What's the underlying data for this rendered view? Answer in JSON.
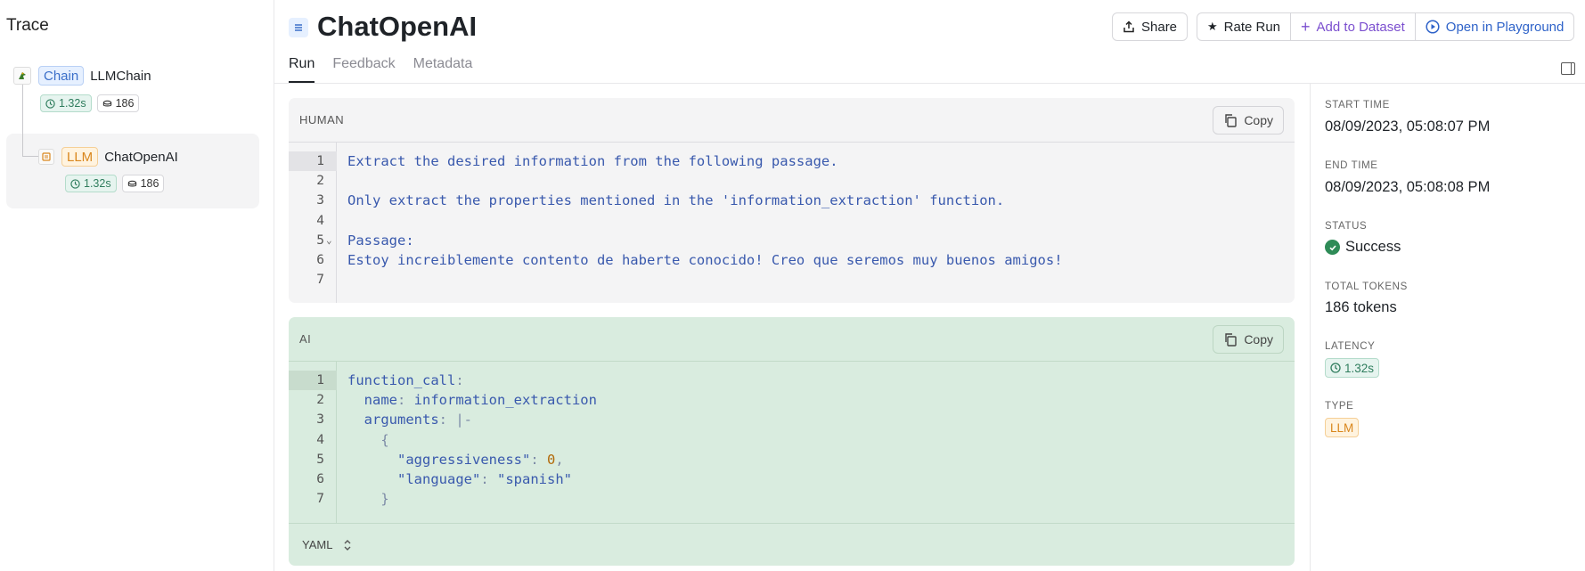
{
  "trace": {
    "title": "Trace",
    "nodes": [
      {
        "type": "Chain",
        "name": "LLMChain",
        "latency": "1.32s",
        "tokens": "186"
      },
      {
        "type": "LLM",
        "name": "ChatOpenAI",
        "latency": "1.32s",
        "tokens": "186"
      }
    ]
  },
  "header": {
    "title": "ChatOpenAI",
    "tabs": [
      "Run",
      "Feedback",
      "Metadata"
    ],
    "actions": {
      "share": "Share",
      "rate": "Rate Run",
      "add_dataset": "Add to Dataset",
      "playground": "Open in Playground"
    }
  },
  "human": {
    "role": "HUMAN",
    "copy_label": "Copy",
    "lines": [
      {
        "n": "1",
        "text": "Extract the desired information from the following passage."
      },
      {
        "n": "2",
        "text": ""
      },
      {
        "n": "3",
        "text": "Only extract the properties mentioned in the 'information_extraction' function."
      },
      {
        "n": "4",
        "text": ""
      },
      {
        "n": "5",
        "text": "Passage:"
      },
      {
        "n": "6",
        "text": "Estoy increiblemente contento de haberte conocido! Creo que seremos muy buenos amigos!"
      },
      {
        "n": "7",
        "text": ""
      }
    ]
  },
  "ai": {
    "role": "AI",
    "copy_label": "Copy",
    "format": "YAML",
    "line_numbers": [
      "1",
      "2",
      "3",
      "4",
      "5",
      "6",
      "7"
    ],
    "function_call_key": "function_call",
    "name_key": "name",
    "name_value": "information_extraction",
    "arguments_key": "arguments",
    "arguments_marker": "|-",
    "open_brace": "{",
    "close_brace": "}",
    "arg1_key": "\"aggressiveness\"",
    "arg1_value": "0",
    "arg2_key": "\"language\"",
    "arg2_value": "\"spanish\""
  },
  "details": {
    "start_time_label": "START TIME",
    "start_time": "08/09/2023, 05:08:07 PM",
    "end_time_label": "END TIME",
    "end_time": "08/09/2023, 05:08:08 PM",
    "status_label": "STATUS",
    "status": "Success",
    "tokens_label": "TOTAL TOKENS",
    "tokens": "186 tokens",
    "latency_label": "LATENCY",
    "latency": "1.32s",
    "type_label": "TYPE",
    "type": "LLM"
  },
  "colors": {
    "success": "#2e8b57",
    "chain_accent": "#3b6fc9",
    "llm_accent": "#d9861c",
    "ai_bg": "#d9ecdf",
    "human_bg": "#f4f4f5"
  }
}
